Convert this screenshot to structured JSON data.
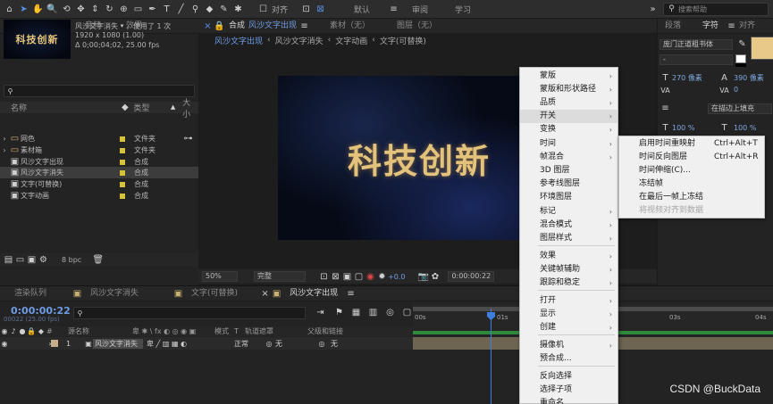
{
  "toolbar": {
    "align_label": "对齐",
    "workspaces": [
      "默认",
      "审阅",
      "学习"
    ],
    "search_placeholder": "搜索帮助"
  },
  "project_panel": {
    "tabs": [
      "项目",
      "信息",
      "音频",
      "效果"
    ],
    "selected_name": "风沙文字消失",
    "used_count": "，使用了 1 次",
    "dimensions": "1920 x 1080 (1.00)",
    "duration": "Δ 0;00;04;02, 25.00 fps",
    "thumbnail_text": "科技创新",
    "headers": [
      "名称",
      "类型",
      "大小"
    ],
    "items": [
      {
        "name": "网色",
        "type": "文件夹"
      },
      {
        "name": "素材箱",
        "type": "文件夹"
      },
      {
        "name": "风沙文字出现",
        "type": "合成"
      },
      {
        "name": "风沙文字消失",
        "type": "合成"
      },
      {
        "name": "文字(可替换)",
        "type": "合成"
      },
      {
        "name": "文字动画",
        "type": "合成"
      }
    ],
    "bit_depth": "8 bpc"
  },
  "viewer": {
    "comp_tab_prefix": "合成",
    "comp_tab_name": "风沙文字出现",
    "other_tabs": [
      "素材（无）",
      "图层（无）"
    ],
    "breadcrumbs": [
      "风沙文字出现",
      "风沙文字消失",
      "文字动画",
      "文字(可替换)"
    ],
    "canvas_text": "科技创新",
    "zoom": "50%",
    "quality": "完整",
    "exposure": "+0.0",
    "timecode": "0:00:00:22"
  },
  "right_panel": {
    "tabs": [
      "段落",
      "字符",
      "对齐"
    ],
    "font_name": "庞门正道粗书体",
    "font_style": "-",
    "leading": "270 像素",
    "tracking": "390 像素",
    "kerning": "0",
    "stroke_mode": "在描边上填充",
    "vscale": "100 %",
    "hscale": "100 %",
    "swatch_color": "#e9c98a"
  },
  "timeline": {
    "tabs": [
      "渲染队列",
      "风沙文字消失",
      "文字(可替换)",
      "风沙文字出现"
    ],
    "current_time": "0:00:00:22",
    "fps_info": "00022 (25.00 fps)",
    "col_headers": [
      "源名称",
      "模式",
      "T",
      "轨道遮罩",
      "父级和链接"
    ],
    "ruler_labels": [
      "00s",
      "01s",
      "02s",
      "03s",
      "04s"
    ],
    "layer": {
      "index": "1",
      "name": "风沙文字消失",
      "mode": "正常",
      "matte": "无",
      "parent": "无"
    }
  },
  "context_menu": {
    "items": [
      {
        "label": "蒙版",
        "sub": true
      },
      {
        "label": "蒙版和形状路径",
        "sub": true
      },
      {
        "label": "品质",
        "sub": true
      },
      {
        "label": "开关",
        "sub": true
      },
      {
        "label": "变换",
        "sub": true
      },
      {
        "label": "时间",
        "sub": true
      },
      {
        "label": "帧混合",
        "sub": true
      },
      {
        "label": "3D 图层",
        "sub": false
      },
      {
        "label": "参考线图层",
        "sub": false
      },
      {
        "label": "环境图层",
        "sub": false
      },
      {
        "label": "标记",
        "sub": true
      },
      {
        "label": "混合模式",
        "sub": true
      },
      {
        "label": "图层样式",
        "sub": true
      },
      {
        "label": "效果",
        "sub": true
      },
      {
        "label": "关键帧辅助",
        "sub": true
      },
      {
        "label": "跟踪和稳定",
        "sub": true
      },
      {
        "label": "打开",
        "sub": true
      },
      {
        "label": "显示",
        "sub": true
      },
      {
        "label": "创建",
        "sub": true
      },
      {
        "label": "摄像机",
        "sub": true
      },
      {
        "label": "预合成...",
        "sub": false
      },
      {
        "label": "反向选择",
        "sub": false
      },
      {
        "label": "选择子项",
        "sub": false
      },
      {
        "label": "重命名",
        "sub": false
      }
    ]
  },
  "time_submenu": {
    "items": [
      {
        "label": "启用时间重映射",
        "shortcut": "Ctrl+Alt+T"
      },
      {
        "label": "时间反向图层",
        "shortcut": "Ctrl+Alt+R"
      },
      {
        "label": "时间伸缩(C)...",
        "shortcut": ""
      },
      {
        "label": "冻结帧",
        "shortcut": ""
      },
      {
        "label": "在最后一帧上冻结",
        "shortcut": ""
      },
      {
        "label": "将视频对齐到数据",
        "shortcut": "",
        "disabled": true
      }
    ]
  },
  "watermark": "CSDN @BuckData"
}
